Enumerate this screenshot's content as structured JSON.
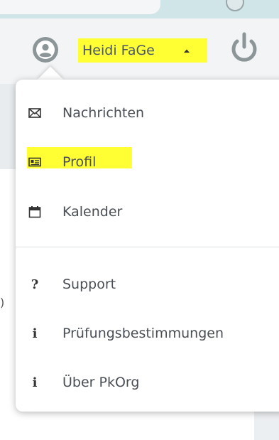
{
  "header": {
    "user_name": "Heidi FaGe",
    "caret_icon": "caret-up-icon",
    "avatar_icon": "user-avatar-icon",
    "power_icon": "power-icon",
    "highlight_color": "#ffff33"
  },
  "menu": {
    "items": [
      {
        "label": "Nachrichten",
        "icon": "envelope-icon"
      },
      {
        "label": "Profil",
        "icon": "id-card-icon",
        "highlighted": true
      },
      {
        "label": "Kalender",
        "icon": "calendar-icon"
      },
      {
        "label": "Support",
        "icon": "question-icon",
        "glyph": "?"
      },
      {
        "label": "Prüfungsbestimmungen",
        "icon": "info-icon",
        "glyph": "i"
      },
      {
        "label": "Über PkOrg",
        "icon": "info-icon",
        "glyph": "i"
      }
    ]
  },
  "background": {
    "left_glyph": ")"
  }
}
